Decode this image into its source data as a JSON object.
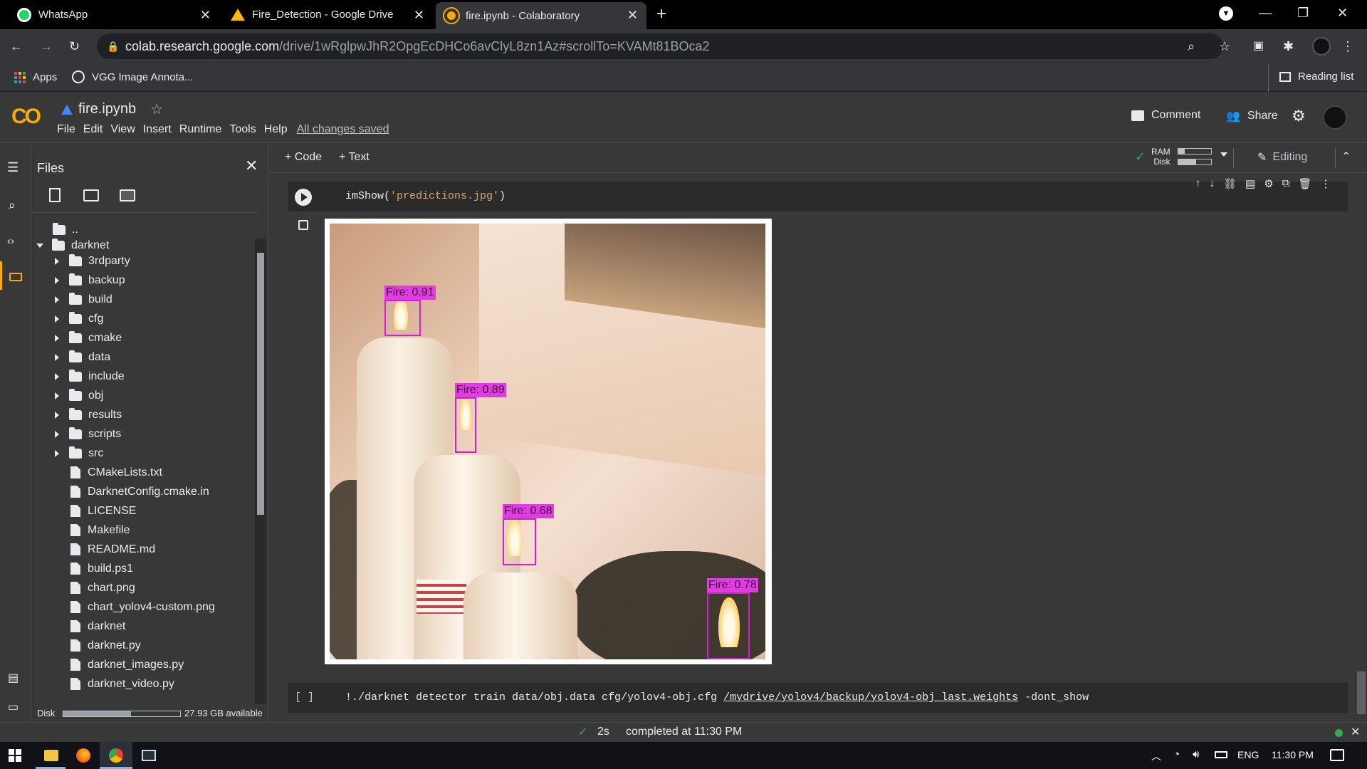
{
  "browser": {
    "tabs": [
      {
        "title": "WhatsApp",
        "icon": "whatsapp-icon",
        "color": "#25d366"
      },
      {
        "title": "Fire_Detection - Google Drive",
        "icon": "google-drive-icon",
        "color": "#fbbc04"
      },
      {
        "title": "fire.ipynb - Colaboratory",
        "icon": "colab-icon",
        "color": "#f9ab00"
      }
    ],
    "url_host": "colab.research.google.com",
    "url_path": "/drive/1wRglpwJhR2OpgEcDHCo6avClyL8zn1Az#scrollTo=KVAMt81BOca2",
    "bookmarks": [
      {
        "label": "Apps",
        "icon": "apps-grid-icon"
      },
      {
        "label": "VGG Image Annota...",
        "icon": "globe-icon"
      }
    ],
    "reading_list": "Reading list"
  },
  "colab": {
    "logo": "CO",
    "notebook_title": "fire.ipynb",
    "menu": [
      "File",
      "Edit",
      "View",
      "Insert",
      "Runtime",
      "Tools",
      "Help"
    ],
    "save_status": "All changes saved",
    "comment_label": "Comment",
    "share_label": "Share",
    "toolbar": {
      "add_code": "+ Code",
      "add_text": "+ Text",
      "ram_label": "RAM",
      "disk_label": "Disk",
      "editing_label": "Editing"
    }
  },
  "files_panel": {
    "title": "Files",
    "parent_dir": "..",
    "root_folder": "darknet",
    "folders": [
      "3rdparty",
      "backup",
      "build",
      "cfg",
      "cmake",
      "data",
      "include",
      "obj",
      "results",
      "scripts",
      "src"
    ],
    "files": [
      "CMakeLists.txt",
      "DarknetConfig.cmake.in",
      "LICENSE",
      "Makefile",
      "README.md",
      "build.ps1",
      "chart.png",
      "chart_yolov4-custom.png",
      "darknet",
      "darknet.py",
      "darknet_images.py",
      "darknet_video.py"
    ],
    "disk_label": "Disk",
    "disk_available": "27.93 GB available",
    "disk_used_fraction": 0.58
  },
  "notebook": {
    "cell1_code_fn": "imShow(",
    "cell1_code_arg": "'predictions.jpg'",
    "cell1_code_end": ")",
    "detections": [
      {
        "label": "Fire: 0.91"
      },
      {
        "label": "Fire: 0.89"
      },
      {
        "label": "Fire: 0.68"
      },
      {
        "label": "Fire: 0.78"
      }
    ],
    "cell2_bracket": "[ ]",
    "cell2_code_a": "!./darknet detector train data/obj.data cfg/yolov4-obj.cfg ",
    "cell2_code_link": "/mydrive/yolov4/backup/yolov4-obj_last.weights",
    "cell2_code_b": " -dont_show"
  },
  "status": {
    "duration": "2s",
    "completed": "completed at 11:30 PM"
  },
  "taskbar": {
    "language": "ENG",
    "time": "11:30 PM"
  }
}
